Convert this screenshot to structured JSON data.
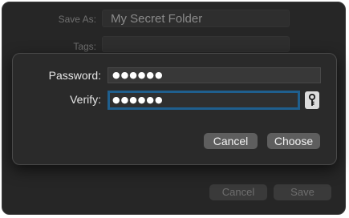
{
  "background_dialog": {
    "save_as_label": "Save As:",
    "save_as_value": "My Secret Folder",
    "tags_label": "Tags:",
    "tags_value": "",
    "cancel_label": "Cancel",
    "save_label": "Save"
  },
  "password_sheet": {
    "password_label": "Password:",
    "password_value": "●●●●●●",
    "verify_label": "Verify:",
    "verify_value": "●●●●●●",
    "cancel_label": "Cancel",
    "choose_label": "Choose",
    "key_icon": "key-icon"
  },
  "colors": {
    "focus_ring": "#1f5f8e",
    "window_bg": "#262626",
    "button_bg": "#5e5e5e"
  }
}
